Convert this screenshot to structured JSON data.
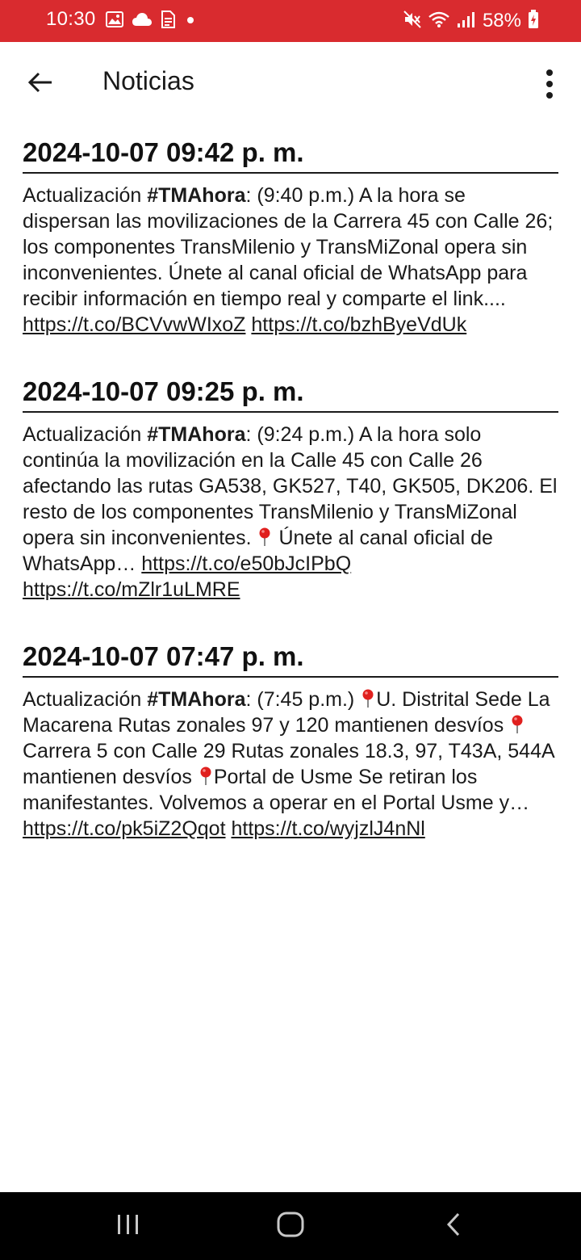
{
  "status_bar": {
    "time": "10:30",
    "battery": "58%",
    "background_color": "#d92b2f",
    "left_icons": [
      "gallery-icon",
      "cloud-icon",
      "document-icon",
      "dot-icon"
    ],
    "right_icons": [
      "mute-icon",
      "wifi-icon",
      "signal-icon",
      "battery-charging-icon"
    ]
  },
  "app_bar": {
    "title": "Noticias",
    "back_icon": "arrow-back-icon",
    "menu_icon": "more-vertical-icon"
  },
  "news": [
    {
      "date": "2024-10-07 09:42 p. m.",
      "prefix": "Actualización ",
      "hashtag": "#TMAhora",
      "text": ": (9:40 p.m.) A la hora se dispersan las movilizaciones de la Carrera 45 con Calle 26; los componentes TransMilenio y TransMiZonal opera sin inconvenientes. Únete al canal oficial de WhatsApp para recibir información en tiempo real y comparte el link.... ",
      "link1": "https://t.co/BCVvwWIxoZ",
      "link2": "https://t.co/bzhByeVdUk"
    },
    {
      "date": "2024-10-07 09:25 p. m.",
      "prefix": "Actualización ",
      "hashtag": "#TMAhora",
      "text_a": ": (9:24 p.m.) A la hora solo continúa la movilización en la Calle 45 con Calle 26 afectando las rutas GA538, GK527, T40, GK505, DK206. El resto de los componentes TransMilenio y TransMiZonal opera sin inconvenientes.",
      "text_b": "Únete al canal oficial de WhatsApp… ",
      "link1": "https://t.co/e50bJcIPbQ",
      "link2": "https://t.co/mZlr1uLMRE"
    },
    {
      "date": "2024-10-07 07:47 p. m.",
      "prefix": "Actualización ",
      "hashtag": "#TMAhora",
      "text_a": ": (7:45 p.m.)",
      "text_b": "U. Distrital Sede La Macarena Rutas zonales 97 y 120 mantienen desvíos",
      "text_c": "Carrera 5 con Calle 29 Rutas zonales 18.3, 97, T43A, 544A mantienen desvíos",
      "text_d": "Portal de Usme Se retiran los manifestantes. Volvemos a operar en el Portal Usme y… ",
      "link1": "https://t.co/pk5iZ2Qqot",
      "link2": "https://t.co/wyjzlJ4nNl"
    }
  ],
  "nav_bar": {
    "icons": [
      "recent-apps-icon",
      "home-icon",
      "back-nav-icon"
    ]
  }
}
